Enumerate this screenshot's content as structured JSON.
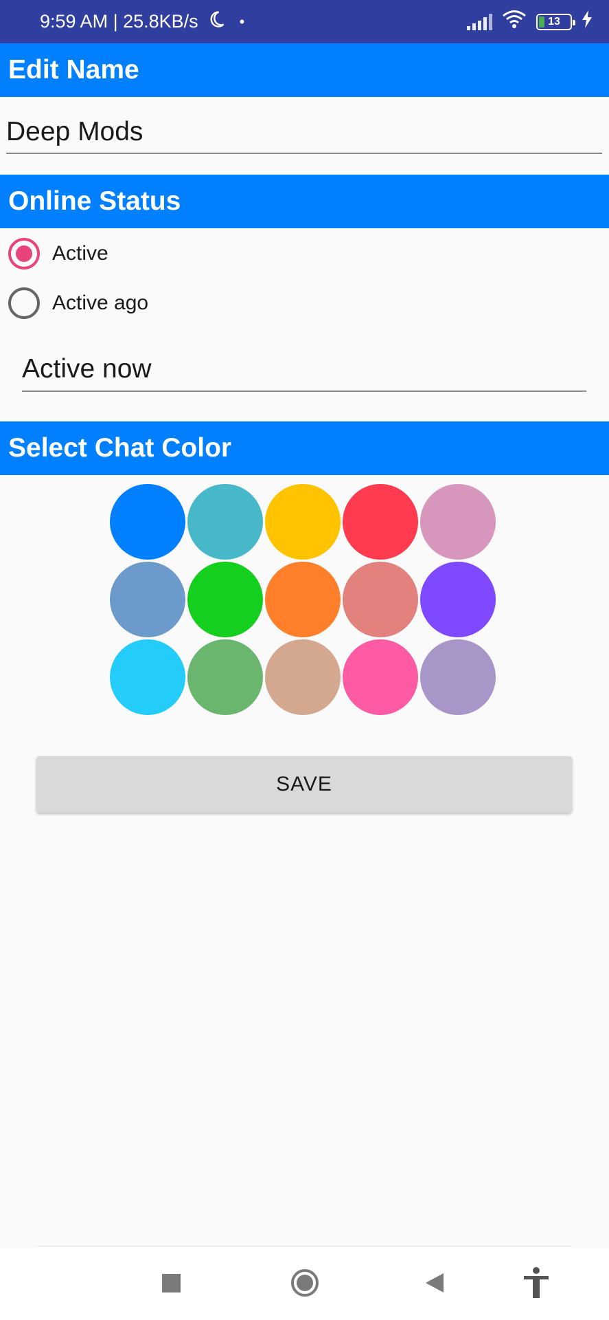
{
  "status_bar": {
    "time": "9:59 AM | 25.8KB/s",
    "dot": "•",
    "battery": "13"
  },
  "edit_name": {
    "header": "Edit Name",
    "name_value": "Deep Mods"
  },
  "online_status": {
    "header": "Online Status",
    "options": [
      {
        "label": "Active",
        "checked": true
      },
      {
        "label": "Active ago",
        "checked": false
      }
    ],
    "status_value": "Active now"
  },
  "chat_color": {
    "header": "Select Chat Color",
    "colors": [
      "#0080ff",
      "#47b8c8",
      "#ffc300",
      "#ff3b4f",
      "#d797bd",
      "#6b9acb",
      "#14cf1e",
      "#ff7f2a",
      "#e3817f",
      "#7e49ff",
      "#24cdf9",
      "#6ab66f",
      "#d4a78f",
      "#ff5ba4",
      "#a996c8"
    ]
  },
  "save_label": "SAVE",
  "icons": {
    "moon": "moon-icon",
    "signal": "signal-icon",
    "wifi": "wifi-icon",
    "battery": "battery-icon",
    "charging": "charging-icon",
    "recents": "recents-icon",
    "home": "home-icon",
    "back": "back-icon",
    "accessibility": "accessibility-icon"
  }
}
